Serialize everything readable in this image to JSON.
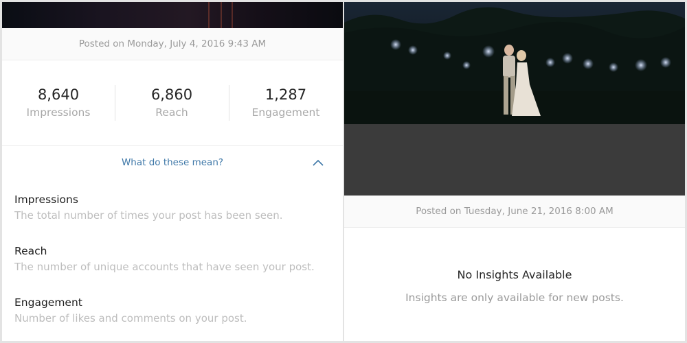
{
  "left_post": {
    "posted_text": "Posted on Monday, July 4, 2016 9:43 AM",
    "stats": [
      {
        "value": "8,640",
        "label": "Impressions"
      },
      {
        "value": "6,860",
        "label": "Reach"
      },
      {
        "value": "1,287",
        "label": "Engagement"
      }
    ],
    "help_link": "What do these mean?",
    "help_icon": "chevron-up-icon",
    "definitions": [
      {
        "term": "Impressions",
        "description": "The total number of times your post has been seen."
      },
      {
        "term": "Reach",
        "description": "The number of unique accounts that have seen your post."
      },
      {
        "term": "Engagement",
        "description": "Number of likes and comments on your post."
      }
    ]
  },
  "right_post": {
    "posted_text": "Posted on Tuesday, June 21, 2016 8:00 AM",
    "empty_title": "No Insights Available",
    "empty_subtitle": "Insights are only available for new posts."
  },
  "colors": {
    "link": "#3f78a8",
    "muted_text": "#9a9a9a",
    "primary_text": "#262626",
    "overlay_gray": "#3b3b3b"
  }
}
